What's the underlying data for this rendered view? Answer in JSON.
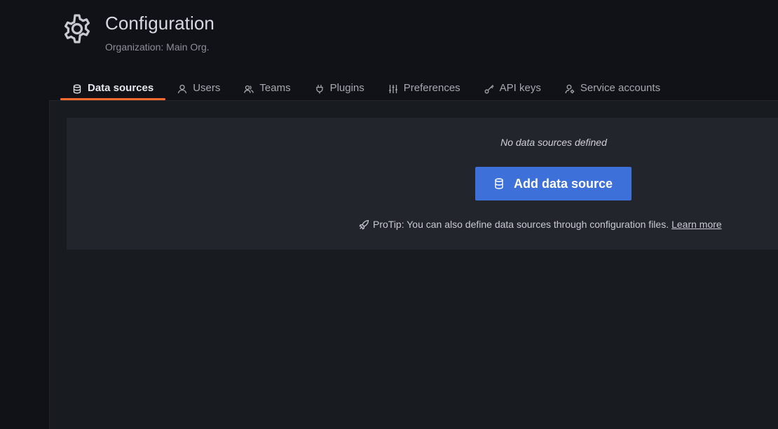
{
  "header": {
    "title": "Configuration",
    "subtitle": "Organization: Main Org.",
    "icon": "gear-icon"
  },
  "tabs": [
    {
      "label": "Data sources",
      "icon": "database-icon",
      "active": true
    },
    {
      "label": "Users",
      "icon": "user-icon",
      "active": false
    },
    {
      "label": "Teams",
      "icon": "users-icon",
      "active": false
    },
    {
      "label": "Plugins",
      "icon": "plug-icon",
      "active": false
    },
    {
      "label": "Preferences",
      "icon": "sliders-icon",
      "active": false
    },
    {
      "label": "API keys",
      "icon": "key-icon",
      "active": false
    },
    {
      "label": "Service accounts",
      "icon": "user-cog-icon",
      "active": false
    }
  ],
  "empty_state": {
    "message": "No data sources defined",
    "button_label": "Add data source",
    "protip_text": "ProTip: You can also define data sources through configuration files.",
    "learn_more": "Learn more"
  },
  "colors": {
    "accent_tab": "#ff6b2c",
    "primary_button": "#3d71d9",
    "background": "#111217",
    "panel": "#22252b"
  }
}
